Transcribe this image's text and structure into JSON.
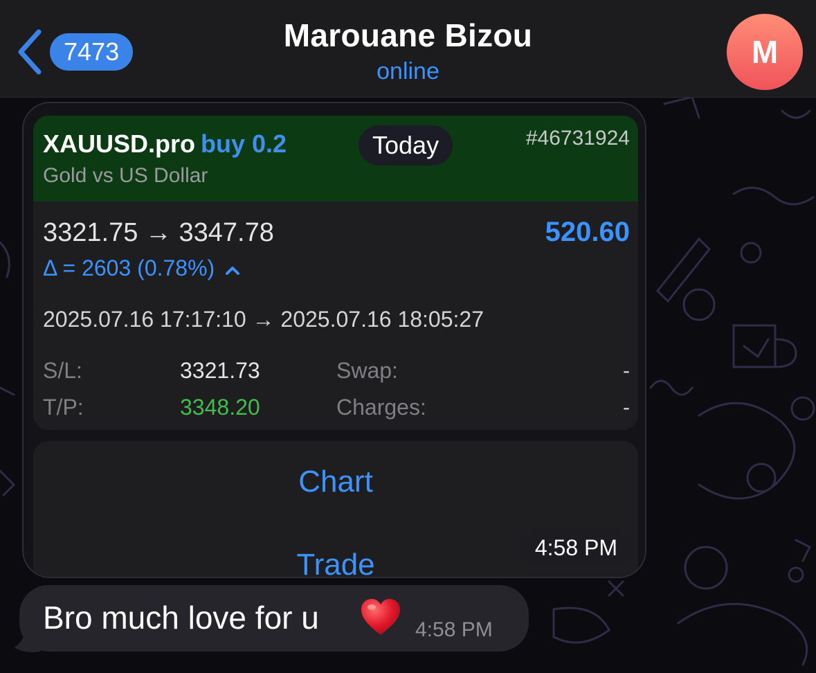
{
  "header": {
    "back_badge": "7473",
    "title": "Marouane Bizou",
    "status": "online",
    "avatar_letter": "M"
  },
  "trade_card": {
    "symbol": "XAUUSD.pro",
    "direction": "buy 0.2",
    "subtitle": "Gold vs US Dollar",
    "ticket": "#46731924",
    "day_chip": "Today",
    "prices": "3321.75 → 3347.78",
    "profit": "520.60",
    "delta": "Δ = 2603 (0.78%)",
    "time_range": "2025.07.16 17:17:10 → 2025.07.16 18:05:27",
    "sl_label": "S/L:",
    "sl_value": "3321.73",
    "tp_label": "T/P:",
    "tp_value": "3348.20",
    "swap_label": "Swap:",
    "swap_value": "-",
    "charges_label": "Charges:",
    "charges_value": "-",
    "chart_button": "Chart",
    "trade_button": "Trade",
    "time": "4:58 PM"
  },
  "message": {
    "text": "Bro much love for u",
    "time": "4:58 PM"
  },
  "colors": {
    "accent": "#3a93ff",
    "card_header": "#0c3a12",
    "profit_green": "#3fbf4a",
    "avatar": "#f0545a"
  },
  "icons": [
    "chevron-left-icon",
    "caret-up-icon",
    "heart-emoji-icon"
  ]
}
